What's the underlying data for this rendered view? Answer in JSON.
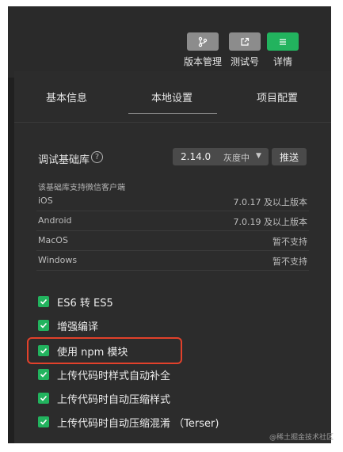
{
  "toolbar": {
    "buttons": [
      {
        "label": "版本管理",
        "icon": "branch-icon"
      },
      {
        "label": "测试号",
        "icon": "external-link-icon"
      },
      {
        "label": "详情",
        "icon": "menu-icon"
      }
    ]
  },
  "tabs": [
    "基本信息",
    "本地设置",
    "项目配置"
  ],
  "active_tab": "本地设置",
  "debug_lib": {
    "title": "调试基础库",
    "help_icon": "?",
    "version": "2.14.0",
    "status": "灰度中",
    "push_label": "推送",
    "support_note": "该基础库支持微信客户端",
    "platforms": [
      {
        "name": "iOS",
        "value": "7.0.17 及以上版本"
      },
      {
        "name": "Android",
        "value": "7.0.19 及以上版本"
      },
      {
        "name": "MacOS",
        "value": "暂不支持"
      },
      {
        "name": "Windows",
        "value": "暂不支持"
      }
    ]
  },
  "options": [
    {
      "label": "ES6 转 ES5",
      "checked": true
    },
    {
      "label": "增强编译",
      "checked": true
    },
    {
      "label": "使用 npm 模块",
      "checked": true,
      "highlighted": true
    },
    {
      "label": "上传代码时样式自动补全",
      "checked": true
    },
    {
      "label": "上传代码时自动压缩样式",
      "checked": true
    },
    {
      "label": "上传代码时自动压缩混淆 （Terser)",
      "checked": true
    }
  ],
  "watermark": "@稀土掘金技术社区",
  "colors": {
    "accent": "#22b35e",
    "highlight": "#e2412b",
    "panel": "#2c2c2c"
  }
}
